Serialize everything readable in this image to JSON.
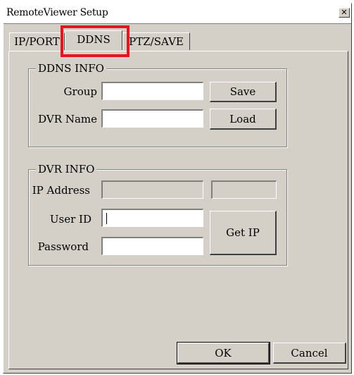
{
  "window": {
    "title": "RemoteViewer Setup",
    "close_glyph": "✕"
  },
  "tabs": [
    {
      "label": "IP/PORT",
      "active": false
    },
    {
      "label": "DDNS",
      "active": true
    },
    {
      "label": "PTZ/SAVE",
      "active": false
    }
  ],
  "highlight_color": "#e8141c",
  "ddns_info": {
    "legend": "DDNS INFO",
    "group_label": "Group",
    "group_value": "",
    "dvr_name_label": "DVR Name",
    "dvr_name_value": "",
    "save_label": "Save",
    "load_label": "Load"
  },
  "dvr_info": {
    "legend": "DVR INFO",
    "ip_label": "IP Address",
    "ip_value": "",
    "port_value": "",
    "user_id_label": "User ID",
    "user_id_value": "",
    "password_label": "Password",
    "password_value": "",
    "get_ip_label": "Get IP"
  },
  "footer": {
    "ok_label": "OK",
    "cancel_label": "Cancel"
  }
}
